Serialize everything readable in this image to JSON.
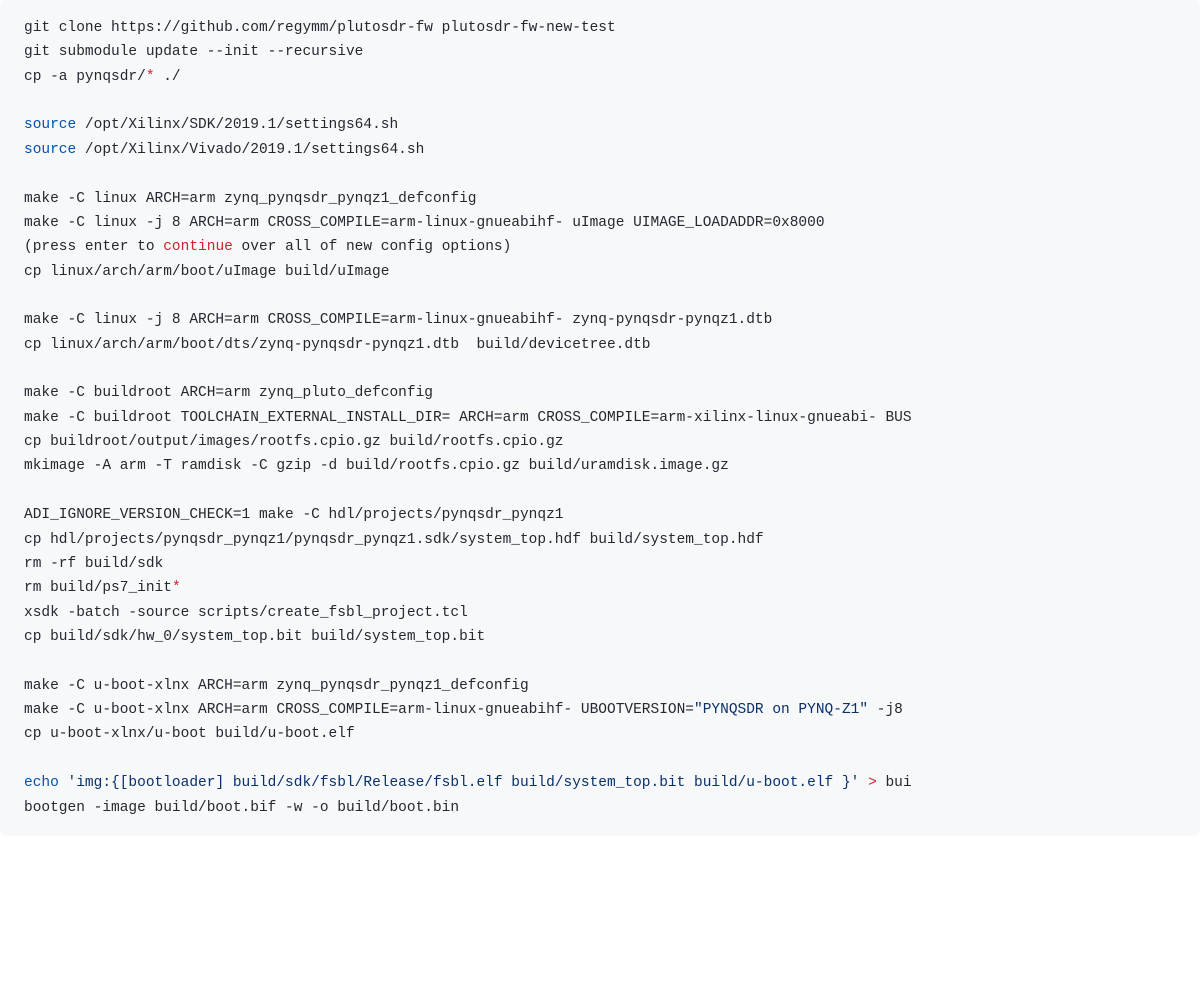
{
  "code": {
    "l1_a": "git clone https://github.com/regymm/plutosdr-fw plutosdr-fw-new-test",
    "l2_a": "git submodule update --init --recursive",
    "l3_a": "cp -a pynqsdr/",
    "l3_b": "*",
    "l3_c": " ./",
    "l5_a": "source",
    "l5_b": " /opt/Xilinx/SDK/2019.1/settings64.sh",
    "l6_a": "source",
    "l6_b": " /opt/Xilinx/Vivado/2019.1/settings64.sh",
    "l8_a": "make -C linux ARCH=arm zynq_pynqsdr_pynqz1_defconfig",
    "l9_a": "make -C linux -j 8 ARCH=arm CROSS_COMPILE=arm-linux-gnueabihf- uImage UIMAGE_LOADADDR=0x8000",
    "l10_a": "(press enter to ",
    "l10_b": "continue",
    "l10_c": " over all of new config options)",
    "l11_a": "cp linux/arch/arm/boot/uImage build/uImage",
    "l13_a": "make -C linux -j 8 ARCH=arm CROSS_COMPILE=arm-linux-gnueabihf- zynq-pynqsdr-pynqz1.dtb",
    "l14_a": "cp linux/arch/arm/boot/dts/zynq-pynqsdr-pynqz1.dtb  build/devicetree.dtb",
    "l16_a": "make -C buildroot ARCH=arm zynq_pluto_defconfig",
    "l17_a": "make -C buildroot TOOLCHAIN_EXTERNAL_INSTALL_DIR= ARCH=arm CROSS_COMPILE=arm-xilinx-linux-gnueabi- BUS",
    "l18_a": "cp buildroot/output/images/rootfs.cpio.gz build/rootfs.cpio.gz",
    "l19_a": "mkimage -A arm -T ramdisk -C gzip -d build/rootfs.cpio.gz build/uramdisk.image.gz",
    "l21_a": "ADI_IGNORE_VERSION_CHECK=1 make -C hdl/projects/pynqsdr_pynqz1",
    "l22_a": "cp hdl/projects/pynqsdr_pynqz1/pynqsdr_pynqz1.sdk/system_top.hdf build/system_top.hdf",
    "l23_a": "rm -rf build/sdk",
    "l24_a": "rm build/ps7_init",
    "l24_b": "*",
    "l25_a": "xsdk -batch -source scripts/create_fsbl_project.tcl",
    "l26_a": "cp build/sdk/hw_0/system_top.bit build/system_top.bit",
    "l28_a": "make -C u-boot-xlnx ARCH=arm zynq_pynqsdr_pynqz1_defconfig",
    "l29_a": "make -C u-boot-xlnx ARCH=arm CROSS_COMPILE=arm-linux-gnueabihf- UBOOTVERSION=",
    "l29_b": "\"PYNQSDR on PYNQ-Z1\"",
    "l29_c": " -j8",
    "l30_a": "cp u-boot-xlnx/u-boot build/u-boot.elf",
    "l32_a": "echo",
    "l32_b": " ",
    "l32_c": "'img:{[bootloader] build/sdk/fsbl/Release/fsbl.elf build/system_top.bit build/u-boot.elf }'",
    "l32_d": " ",
    "l32_e": ">",
    "l32_f": " bui",
    "l33_a": "bootgen -image build/boot.bif -w -o build/boot.bin"
  }
}
